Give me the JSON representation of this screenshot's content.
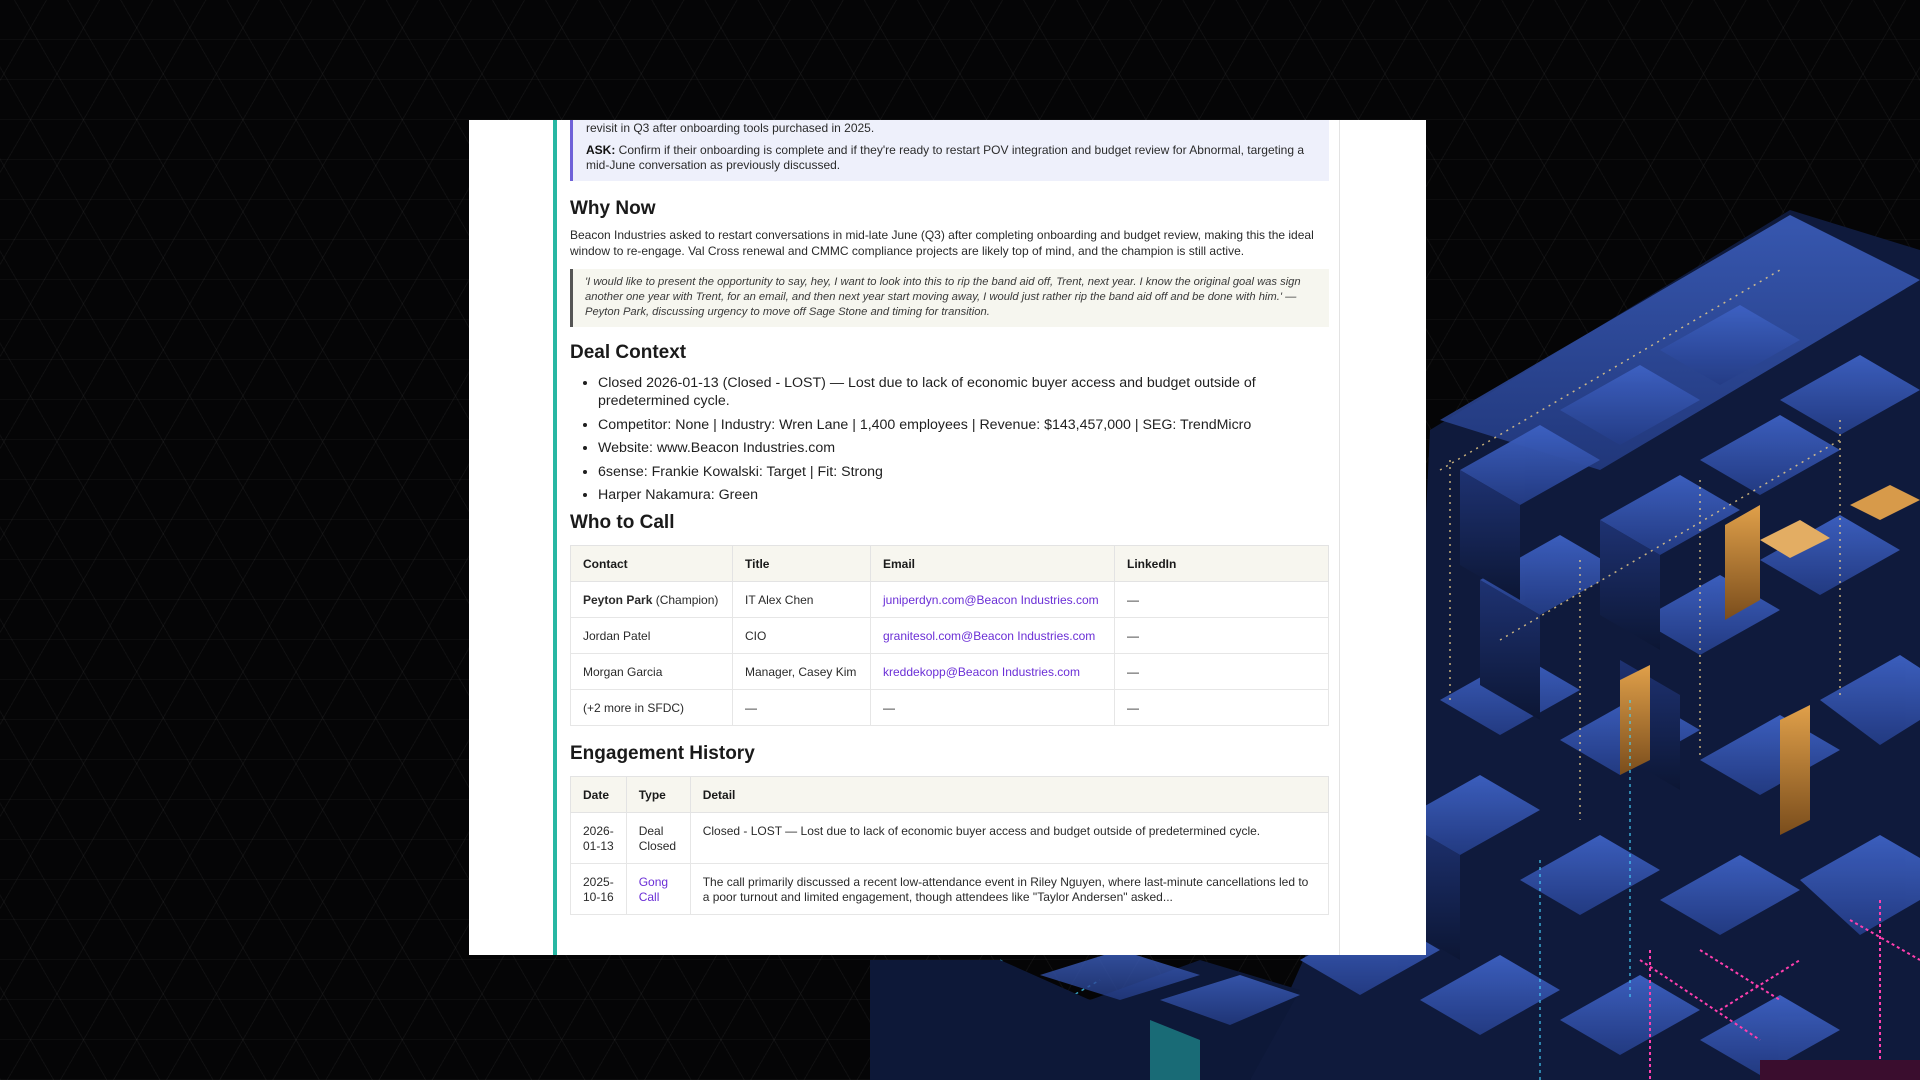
{
  "ask_box": {
    "partial_line": "revisit in Q3 after onboarding tools purchased in 2025.",
    "ask_label": "ASK:",
    "ask_text": " Confirm if their onboarding is complete and if they're ready to restart POV integration and budget review for Abnormal, targeting a mid-June conversation as previously discussed."
  },
  "why_now": {
    "heading": "Why Now",
    "text": "Beacon Industries asked to restart conversations in mid-late June (Q3) after completing onboarding and budget review, making this the ideal window to re-engage. Val Cross renewal and CMMC compliance projects are likely top of mind, and the champion is still active.",
    "quote": "'I would like to present the opportunity to say, hey, I want to look into this to rip the band aid off, Trent, next year. I know the original goal was sign another one year with Trent, for an email, and then next year start moving away, I would just rather rip the band aid off and be done with him.' — Peyton Park, discussing urgency to move off Sage Stone and timing for transition."
  },
  "deal_context": {
    "heading": "Deal Context",
    "items": [
      "Closed 2026-01-13 (Closed - LOST) — Lost due to lack of economic buyer access and budget outside of predetermined cycle.",
      "Competitor: None | Industry: Wren Lane | 1,400 employees | Revenue: $143,457,000 | SEG: TrendMicro",
      "Website: www.Beacon Industries.com",
      "6sense: Frankie Kowalski: Target | Fit: Strong",
      "Harper Nakamura: Green"
    ]
  },
  "who_to_call": {
    "heading": "Who to Call",
    "columns": [
      "Contact",
      "Title",
      "Email",
      "LinkedIn"
    ],
    "rows": [
      {
        "name": "Peyton Park",
        "role": " (Champion)",
        "title": "IT Alex Chen",
        "email": "juniperdyn.com@Beacon Industries.com",
        "linkedin": "—"
      },
      {
        "name": "Jordan Patel",
        "title": "CIO",
        "email": "granitesol.com@Beacon Industries.com",
        "linkedin": "—"
      },
      {
        "name": "Morgan Garcia",
        "title": "Manager, Casey Kim",
        "email": "kreddekopp@Beacon Industries.com",
        "linkedin": "—"
      },
      {
        "name": "(+2 more in SFDC)",
        "title": "—",
        "email": "—",
        "linkedin": "—"
      }
    ]
  },
  "engagement_history": {
    "heading": "Engagement History",
    "columns": [
      "Date",
      "Type",
      "Detail"
    ],
    "rows": [
      {
        "date": "2026-01-13",
        "type": "Deal Closed",
        "detail": "Closed - LOST — Lost due to lack of economic buyer access and budget outside of predetermined cycle."
      },
      {
        "date": "2025-10-16",
        "type": "Gong Call",
        "detail": "The call primarily discussed a recent low-attendance event in Riley Nguyen, where last-minute cancellations led to a poor turnout and limited engagement, though attendees like \"Taylor Andersen\" asked..."
      }
    ]
  },
  "colors": {
    "accent_bar": "#27b7a3",
    "ask_border": "#6f62d8",
    "link": "#6b2fd6"
  }
}
